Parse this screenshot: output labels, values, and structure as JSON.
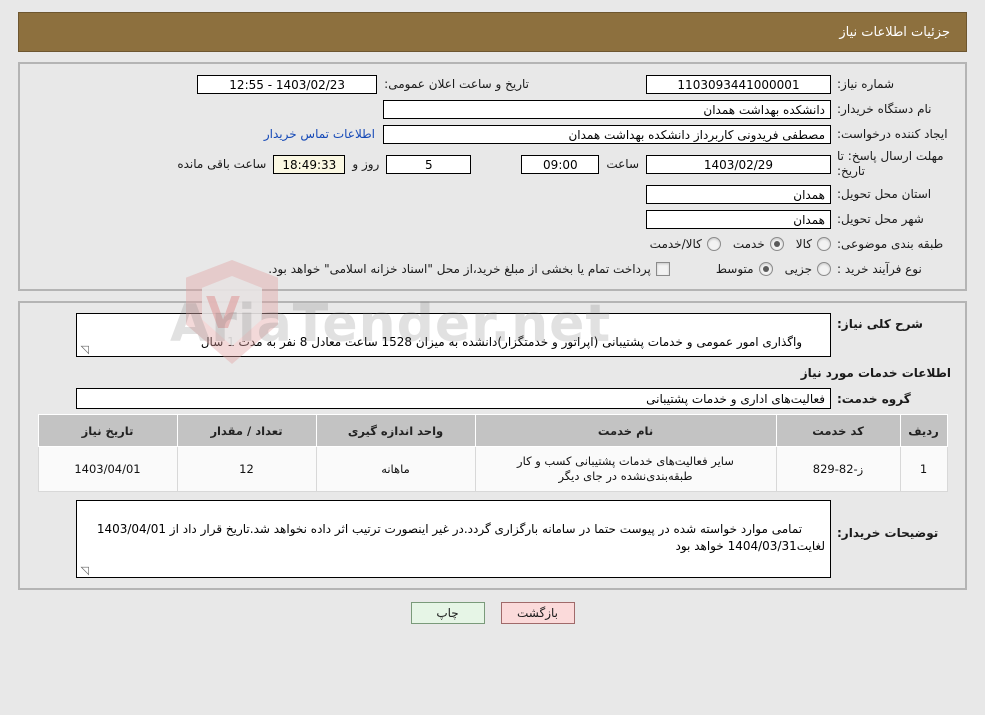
{
  "header": {
    "title": "جزئیات اطلاعات نیاز"
  },
  "summary": {
    "need_number_label": "شماره نیاز:",
    "need_number_value": "1103093441000001",
    "announce_label": "تاریخ و ساعت اعلان عمومی:",
    "announce_value": "1403/02/23 - 12:55",
    "buyer_org_label": "نام دستگاه خریدار:",
    "buyer_org_value": "دانشکده بهداشت همدان",
    "creator_label": "ایجاد کننده درخواست:",
    "creator_value": "مصطفی فریدونی کاربرداز دانشکده بهداشت همدان",
    "contact_link": "اطلاعات تماس خریدار",
    "deadline_label": "مهلت ارسال پاسخ: تا تاریخ:",
    "deadline_date": "1403/02/29",
    "hour_label": "ساعت",
    "deadline_time": "09:00",
    "days_value": "5",
    "days_label": "روز و",
    "countdown_value": "18:49:33",
    "countdown_label": "ساعت باقی مانده",
    "province_label": "استان محل تحویل:",
    "province_value": "همدان",
    "city_label": "شهر محل تحویل:",
    "city_value": "همدان",
    "category_label": "طبقه بندی موضوعی:",
    "category_options": [
      {
        "label": "کالا",
        "selected": false
      },
      {
        "label": "خدمت",
        "selected": true
      },
      {
        "label": "کالا/خدمت",
        "selected": false
      }
    ],
    "process_label": "نوع فرآیند خرید :",
    "process_options": [
      {
        "label": "جزیی",
        "selected": false
      },
      {
        "label": "متوسط",
        "selected": true
      }
    ],
    "treasury_checkbox_label": "پرداخت تمام یا بخشی از مبلغ خرید،از محل \"اسناد خزانه اسلامی\" خواهد بود.",
    "treasury_checked": false
  },
  "details": {
    "overview_label": "شرح کلی نیاز:",
    "overview_value": "واگذاری امور عمومی و خدمات پشتیبانی (اپراتور و خدمتگزار)دانشده به میزان 1528 ساعت معادل 8 نفر به مدت 1 سال",
    "services_section_title": "اطلاعات خدمات مورد نیاز",
    "service_group_label": "گروه خدمت:",
    "service_group_value": "فعالیت‌های اداری و خدمات پشتیبانی",
    "table": {
      "columns": [
        "ردیف",
        "کد خدمت",
        "نام خدمت",
        "واحد اندازه گیری",
        "تعداد / مقدار",
        "تاریخ نیاز"
      ],
      "rows": [
        {
          "index": "1",
          "code": "ز-82-829",
          "name": "سایر فعالیت‌های خدمات پشتیبانی کسب و کار طبقه‌بندی‌نشده در جای دیگر",
          "unit": "ماهانه",
          "qty": "12",
          "date": "1403/04/01"
        }
      ]
    },
    "buyer_notes_label": "توضیحات خریدار:",
    "buyer_notes_value": "تمامی موارد خواسته شده در پیوست حتما در سامانه بارگزاری گردد.در غیر اینصورت ترتیب اثر داده نخواهد شد.تاریخ قرار داد از 1403/04/01 لغایت1404/03/31 خواهد بود"
  },
  "footer": {
    "print_label": "چاپ",
    "back_label": "بازگشت"
  },
  "watermark": {
    "text": "AriaTender.net"
  }
}
